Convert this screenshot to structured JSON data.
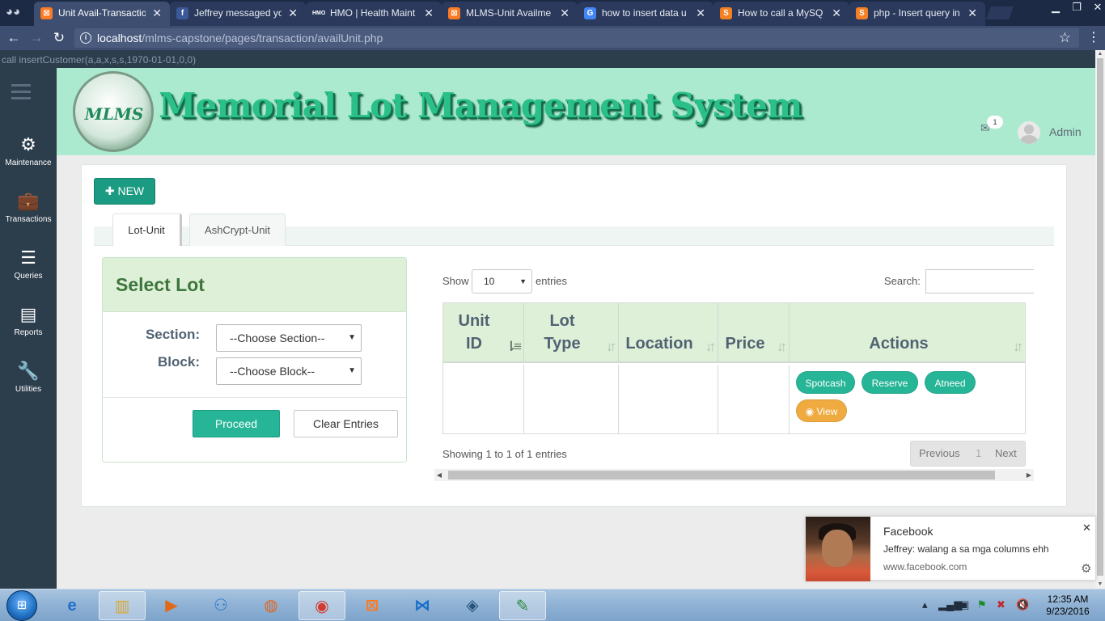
{
  "browser": {
    "tabs": [
      {
        "title": "Unit Avail-Transactio",
        "icon": "xampp-icon",
        "icon_text": "⊠",
        "icon_color": "#fb7a24"
      },
      {
        "title": "Jeffrey messaged yo",
        "icon": "facebook-icon",
        "icon_text": "f",
        "icon_color": "#3b5998"
      },
      {
        "title": "HMO | Health Maint",
        "icon": "hmo-icon",
        "icon_text": "HMO",
        "icon_color": "#2b3a5c"
      },
      {
        "title": "MLMS-Unit Availme",
        "icon": "xampp-icon",
        "icon_text": "⊠",
        "icon_color": "#fb7a24"
      },
      {
        "title": "how to insert data u",
        "icon": "google-icon",
        "icon_text": "G",
        "icon_color": "#4285f4"
      },
      {
        "title": "How to call a MySQ",
        "icon": "stackoverflow-icon",
        "icon_text": "S",
        "icon_color": "#f48024"
      },
      {
        "title": "php - Insert query in",
        "icon": "stackoverflow-icon",
        "icon_text": "S",
        "icon_color": "#f48024"
      }
    ],
    "url_host": "localhost",
    "url_path": "/mlms-capstone/pages/transaction/availUnit.php"
  },
  "debug_text": "call insertCustomer(a,a,x,s,s,1970-01-01,0,0)",
  "sidebar": {
    "items": [
      {
        "label": "Maintenance",
        "icon": "gear-icon",
        "glyph": "⚙"
      },
      {
        "label": "Transactions",
        "icon": "briefcase-icon",
        "glyph": "💼"
      },
      {
        "label": "Queries",
        "icon": "list-icon",
        "glyph": "☰"
      },
      {
        "label": "Reports",
        "icon": "report-icon",
        "glyph": "▤"
      },
      {
        "label": "Utilities",
        "icon": "wrench-icon",
        "glyph": "🔧"
      }
    ]
  },
  "header": {
    "logo_text": "MLMS",
    "brand": "Memorial Lot Management System",
    "mail_count": "1",
    "user": "Admin"
  },
  "toolbar": {
    "new_label": "NEW"
  },
  "page_tabs": [
    {
      "label": "Lot-Unit",
      "active": true
    },
    {
      "label": "AshCrypt-Unit",
      "active": false
    }
  ],
  "select_lot": {
    "title": "Select Lot",
    "section_label": "Section:",
    "section_value": "--Choose Section--",
    "block_label": "Block:",
    "block_value": "--Choose Block--",
    "proceed_label": "Proceed",
    "clear_label": "Clear Entries"
  },
  "datatable": {
    "show_label": "Show",
    "length_value": "10",
    "entries_label": "entries",
    "search_label": "Search:",
    "search_value": "",
    "columns": [
      {
        "line1": "Unit",
        "line2": "ID"
      },
      {
        "line1": "Lot",
        "line2": "Type"
      },
      {
        "line1": "",
        "line2": "Location"
      },
      {
        "line1": "",
        "line2": "Price"
      },
      {
        "line1": "",
        "line2": "Actions"
      }
    ],
    "row_actions": {
      "spotcash": "Spotcash",
      "reserve": "Reserve",
      "atneed": "Atneed",
      "view": "View"
    },
    "info": "Showing 1 to 1 of 1 entries",
    "prev": "Previous",
    "page": "1",
    "next": "Next"
  },
  "notification": {
    "title": "Facebook",
    "message": "Jeffrey: walang a sa mga columns ehh",
    "source": "www.facebook.com"
  },
  "taskbar": {
    "time": "12:35 AM",
    "date": "9/23/2016"
  }
}
